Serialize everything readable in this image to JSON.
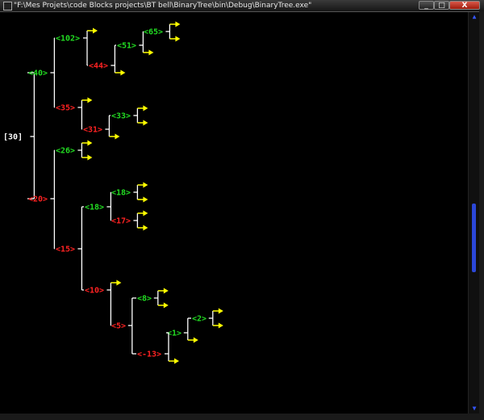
{
  "window": {
    "title": "\"F:\\Mes Projets\\code Blocks projects\\BT bell\\BinaryTree\\bin\\Debug\\BinaryTree.exe\"",
    "min_glyph": "_",
    "max_glyph": "□",
    "close_glyph": "X"
  },
  "console": {
    "colors": {
      "background": "#000000",
      "line": "#ffffff",
      "root": "#ffffff",
      "left_node": "#22dd22",
      "right_node": "#ff2222",
      "null_arrow": "#ffff00"
    },
    "root": {
      "value": "30",
      "text": "[30]"
    },
    "nodes": [
      {
        "id": "40",
        "text": "<40>",
        "color": "green"
      },
      {
        "id": "102",
        "text": "<102>",
        "color": "green"
      },
      {
        "id": "44",
        "text": "<44>",
        "color": "red"
      },
      {
        "id": "51",
        "text": "<51>",
        "color": "green"
      },
      {
        "id": "65",
        "text": "<65>",
        "color": "green"
      },
      {
        "id": "35",
        "text": "<35>",
        "color": "red"
      },
      {
        "id": "31",
        "text": "<31>",
        "color": "red"
      },
      {
        "id": "33",
        "text": "<33>",
        "color": "green"
      },
      {
        "id": "20",
        "text": "<20>",
        "color": "red"
      },
      {
        "id": "26",
        "text": "<26>",
        "color": "green"
      },
      {
        "id": "15",
        "text": "<15>",
        "color": "red"
      },
      {
        "id": "18",
        "text": "<18>",
        "color": "green"
      },
      {
        "id": "18b",
        "text": "<18>",
        "color": "green"
      },
      {
        "id": "17",
        "text": "<17>",
        "color": "red"
      },
      {
        "id": "10",
        "text": "<10>",
        "color": "red"
      },
      {
        "id": "5",
        "text": "<5>",
        "color": "red"
      },
      {
        "id": "8",
        "text": "<8>",
        "color": "green"
      },
      {
        "id": "-13",
        "text": "<-13>",
        "color": "red"
      },
      {
        "id": "1",
        "text": "<1>",
        "color": "green"
      },
      {
        "id": "2",
        "text": "<2>",
        "color": "green"
      }
    ]
  },
  "scrollbar": {
    "position": 0.58,
    "visible_fraction": 0.18,
    "up_glyph": "▲",
    "down_glyph": "▼"
  }
}
